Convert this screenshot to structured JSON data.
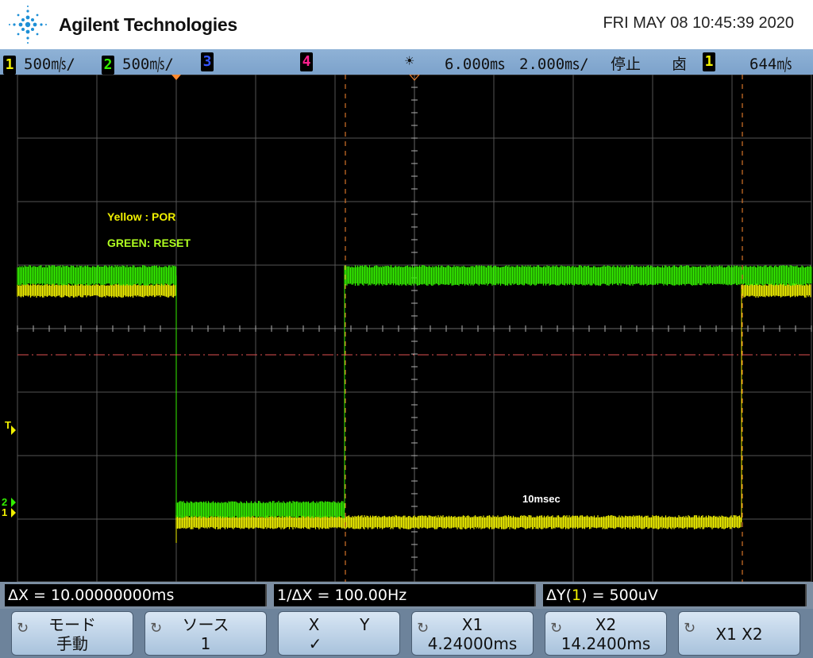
{
  "header": {
    "brand": "Agilent Technologies",
    "datetime": "FRI MAY 08 10:45:39 2020"
  },
  "status": {
    "ch1_num": "1",
    "ch1_scale": "500㎧/",
    "ch2_num": "2",
    "ch2_scale": "500㎧/",
    "ch3_num": "3",
    "ch4_num": "4",
    "trig_icon": "☀",
    "time_delay": "6.000㎳",
    "time_scale": "2.000㎳/",
    "run_state": "停止",
    "trig_edge": "⻧",
    "trig_src": "1",
    "trig_level": "644㎧"
  },
  "screen": {
    "annot_yellow": "Yellow : POR",
    "annot_green": "GREEN: RESET",
    "annot_time": "10msec",
    "marker_t": "T",
    "marker_2": "2",
    "marker_1": "1"
  },
  "measurements": {
    "dx": "ΔX = 10.00000000ms",
    "inv_dx": "1/ΔX = 100.00Hz",
    "dy_prefix": "ΔY(",
    "dy_ch": "1",
    "dy_suffix": ") = 500uV"
  },
  "softkeys": [
    {
      "l1": "モード",
      "l2": "手動"
    },
    {
      "l1": "ソース",
      "l2": "1"
    },
    {
      "l1": "X        Y",
      "l2": "✓"
    },
    {
      "l1": "X1",
      "l2": "4.24000ms"
    },
    {
      "l1": "X2",
      "l2": "14.2400ms"
    },
    {
      "l1": "X1 X2",
      "l2": ""
    }
  ],
  "colors": {
    "ch1": "#f0f000",
    "ch2": "#33ee00",
    "ch3": "#3355ff",
    "ch4": "#ff1f8f",
    "grid": "#b0b0b0",
    "cursor": "#ff8a30",
    "background": "#000000"
  }
}
